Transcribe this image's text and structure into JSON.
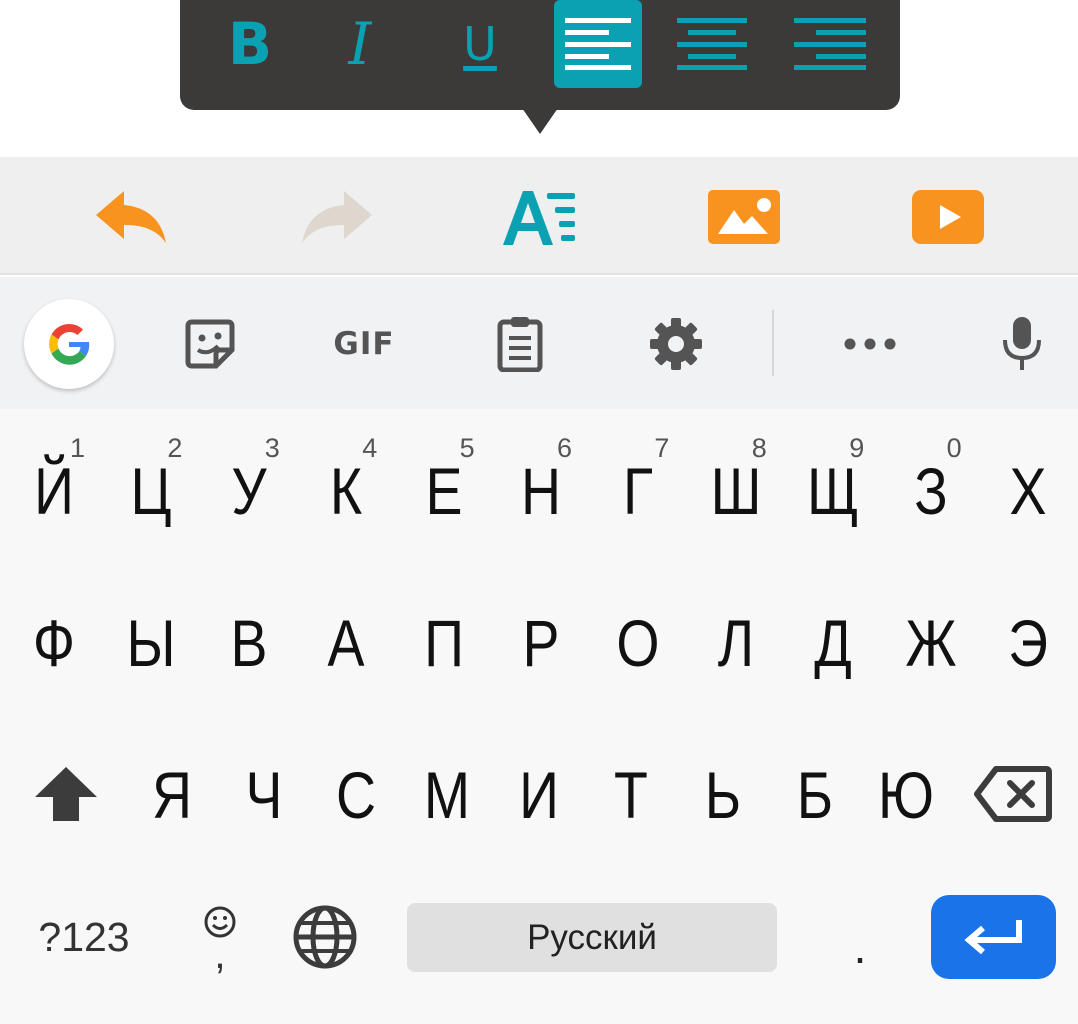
{
  "format_popup": {
    "bold_label": "B",
    "italic_label": "I",
    "underline_label": "U",
    "active_alignment": "left",
    "accent_color": "#0aa2b2",
    "background_color": "#3b3a38"
  },
  "editor_toolbar": {
    "icons": [
      "undo-icon",
      "redo-icon",
      "text-format-icon",
      "insert-image-icon",
      "insert-video-icon"
    ],
    "accent_color": "#f7931e",
    "undo_enabled": true,
    "redo_enabled": false
  },
  "suggestion_strip": {
    "gif_label": "GIF",
    "icons": [
      "google-icon",
      "sticker-icon",
      "clipboard-icon",
      "gear-icon",
      "more-icon",
      "microphone-icon"
    ]
  },
  "keyboard": {
    "row1": [
      {
        "letter": "Й",
        "num": "1"
      },
      {
        "letter": "Ц",
        "num": "2"
      },
      {
        "letter": "У",
        "num": "3"
      },
      {
        "letter": "К",
        "num": "4"
      },
      {
        "letter": "Е",
        "num": "5"
      },
      {
        "letter": "Н",
        "num": "6"
      },
      {
        "letter": "Г",
        "num": "7"
      },
      {
        "letter": "Ш",
        "num": "8"
      },
      {
        "letter": "Щ",
        "num": "9"
      },
      {
        "letter": "З",
        "num": "0"
      },
      {
        "letter": "Х",
        "num": ""
      }
    ],
    "row2": [
      "Ф",
      "Ы",
      "В",
      "А",
      "П",
      "Р",
      "О",
      "Л",
      "Д",
      "Ж",
      "Э"
    ],
    "row3": [
      "Я",
      "Ч",
      "С",
      "М",
      "И",
      "Т",
      "Ь",
      "Б",
      "Ю"
    ],
    "symbols_label": "?123",
    "emoji_comma_label": ",",
    "space_label": "Русский",
    "period_label": ".",
    "enter_color": "#1a73e8"
  }
}
